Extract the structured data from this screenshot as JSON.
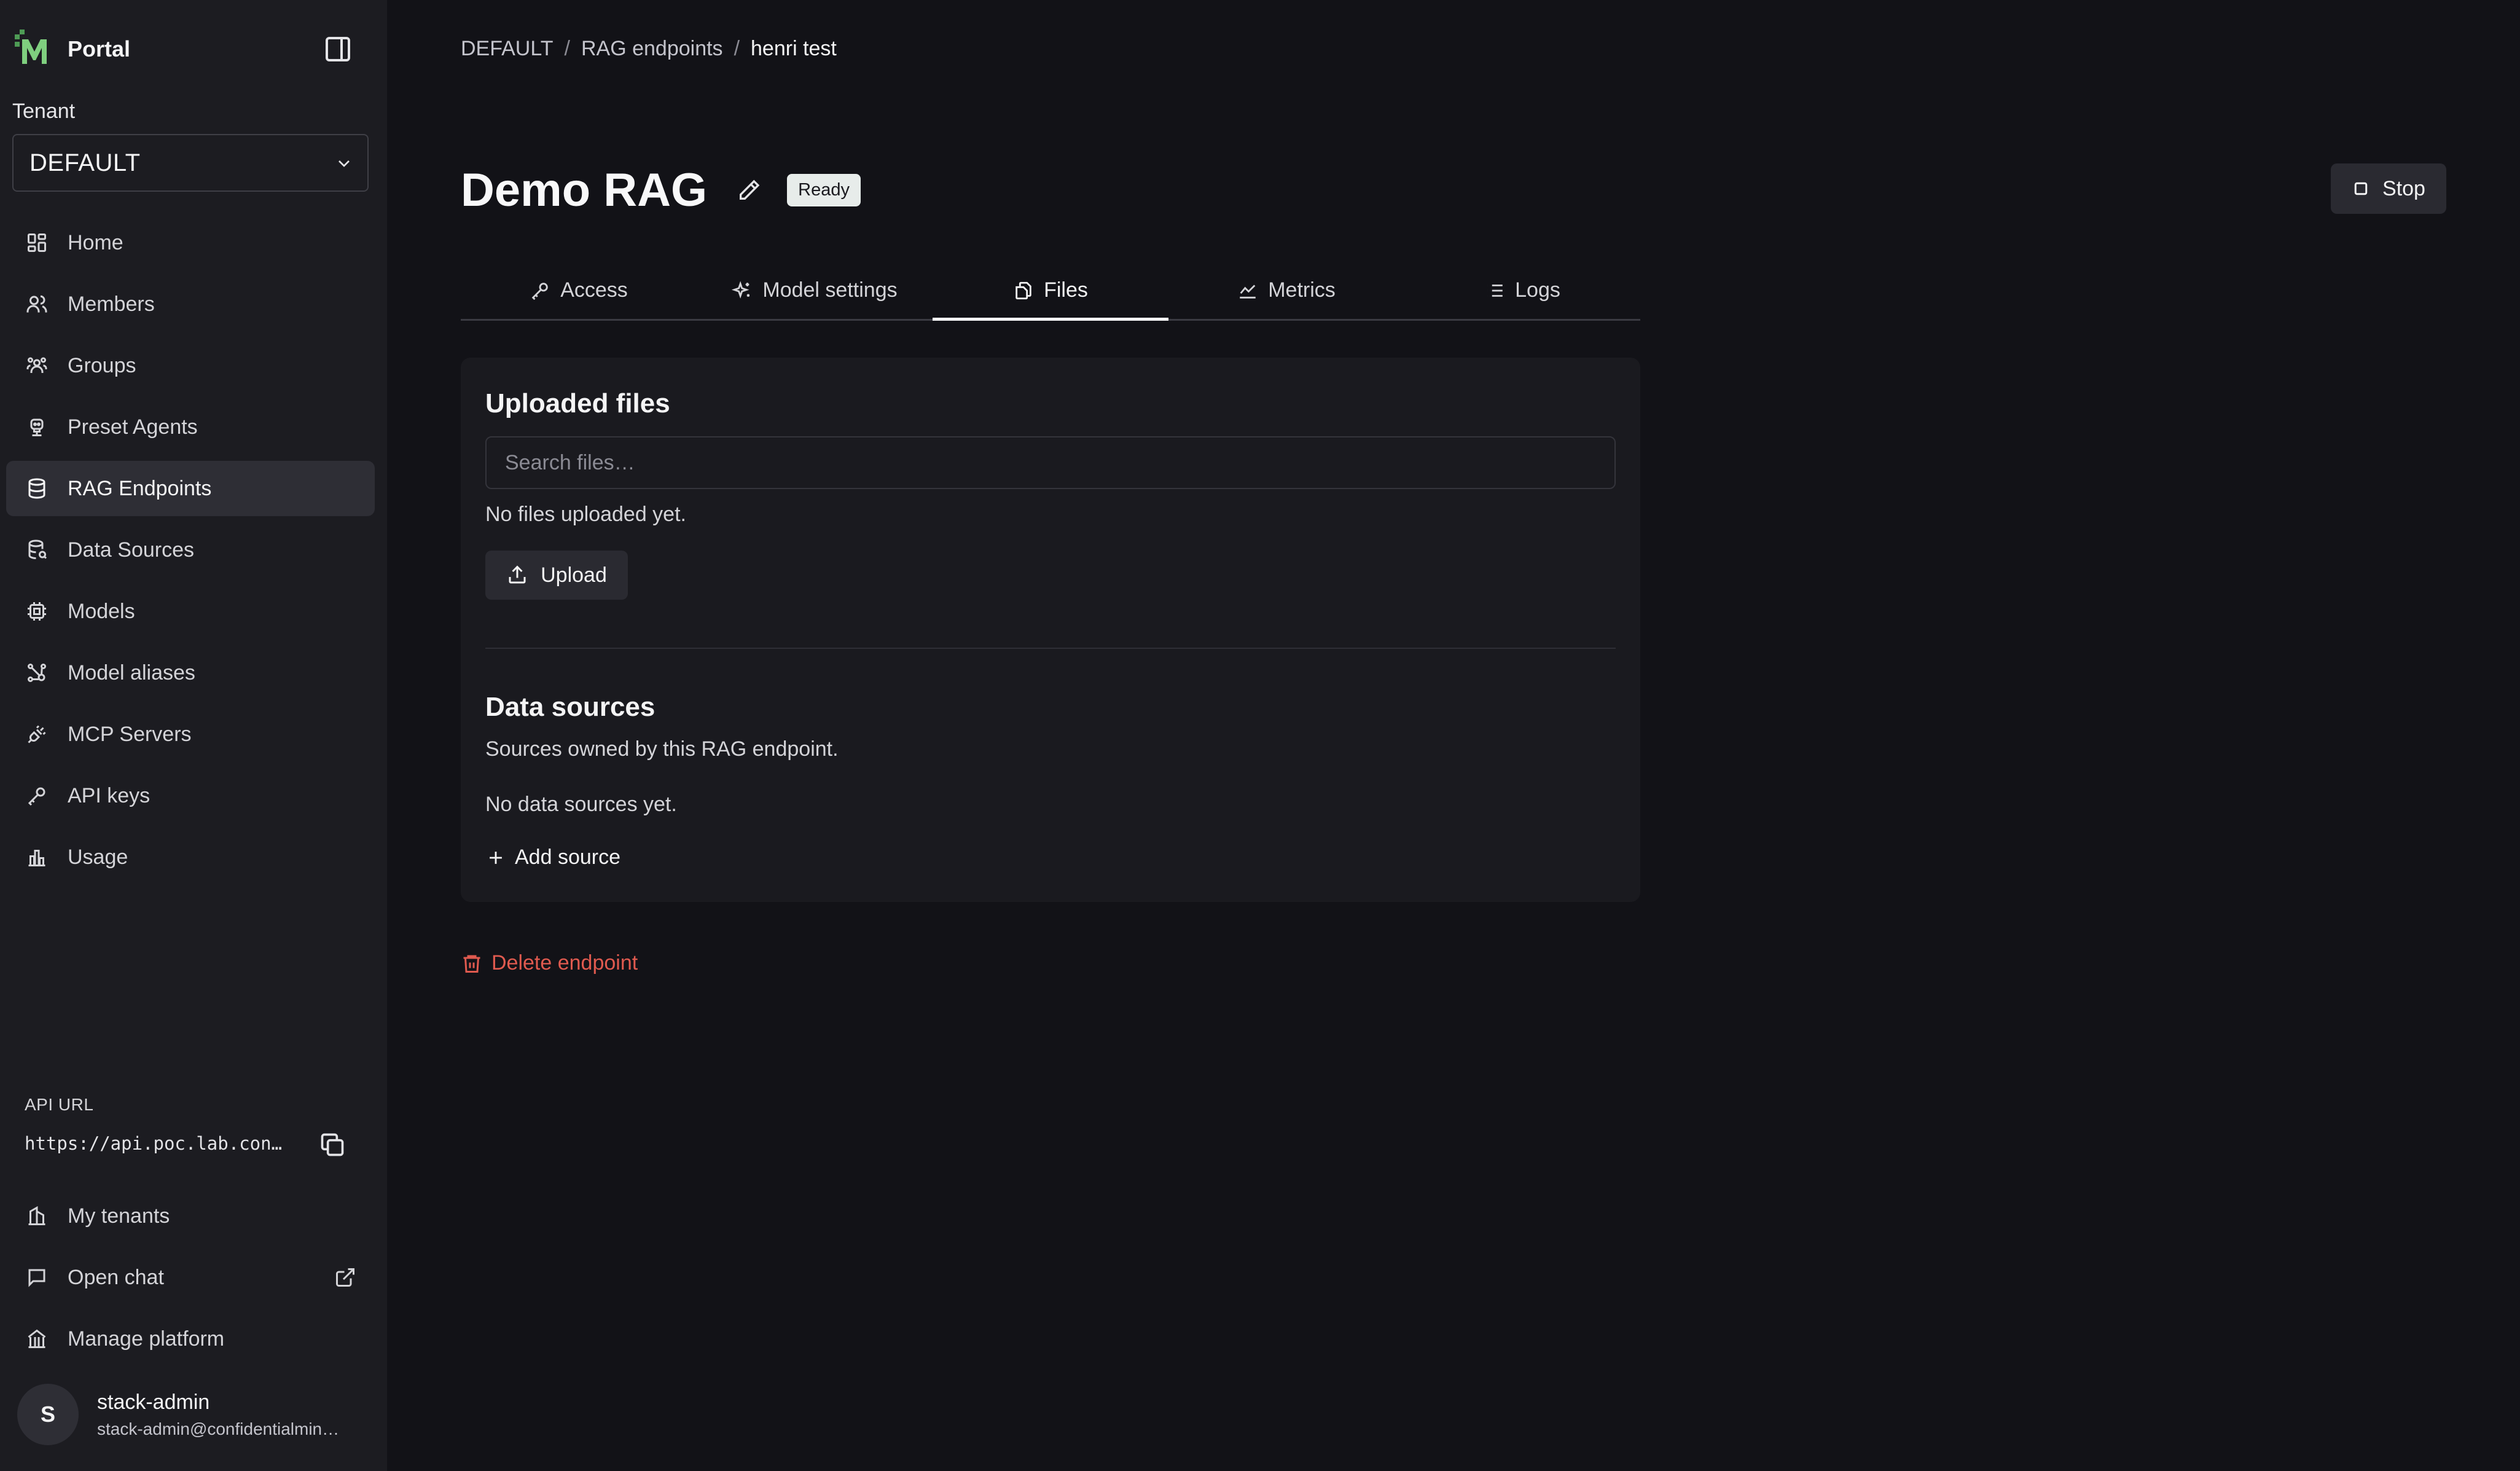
{
  "app": {
    "name": "Portal"
  },
  "sidebar": {
    "tenant_label": "Tenant",
    "tenant_value": "DEFAULT",
    "items": [
      {
        "label": "Home",
        "icon": "dashboard-icon"
      },
      {
        "label": "Members",
        "icon": "users-icon"
      },
      {
        "label": "Groups",
        "icon": "group-icon"
      },
      {
        "label": "Preset Agents",
        "icon": "robot-icon"
      },
      {
        "label": "RAG Endpoints",
        "icon": "database-icon",
        "active": true
      },
      {
        "label": "Data Sources",
        "icon": "database-search-icon"
      },
      {
        "label": "Models",
        "icon": "cpu-icon"
      },
      {
        "label": "Model aliases",
        "icon": "share-nodes-icon"
      },
      {
        "label": "MCP Servers",
        "icon": "plug-icon"
      },
      {
        "label": "API keys",
        "icon": "key-icon"
      },
      {
        "label": "Usage",
        "icon": "bar-chart-icon"
      }
    ],
    "api_url_label": "API URL",
    "api_url": "https://api.poc.lab.con…",
    "bottom_items": [
      {
        "label": "My tenants",
        "icon": "building-icon"
      },
      {
        "label": "Open chat",
        "icon": "chat-icon"
      },
      {
        "label": "Manage platform",
        "icon": "landmark-icon"
      }
    ],
    "user": {
      "initial": "S",
      "name": "stack-admin",
      "email": "stack-admin@confidentialmin…"
    }
  },
  "breadcrumb": [
    "DEFAULT",
    "RAG endpoints",
    "henri test"
  ],
  "page": {
    "title": "Demo RAG",
    "status": "Ready",
    "stop_label": "Stop"
  },
  "tabs": [
    {
      "label": "Access",
      "icon": "key-icon"
    },
    {
      "label": "Model settings",
      "icon": "sparkles-icon"
    },
    {
      "label": "Files",
      "icon": "files-icon",
      "active": true
    },
    {
      "label": "Metrics",
      "icon": "line-chart-icon"
    },
    {
      "label": "Logs",
      "icon": "list-icon"
    }
  ],
  "files": {
    "title": "Uploaded files",
    "search_placeholder": "Search files…",
    "empty": "No files uploaded yet.",
    "upload_label": "Upload"
  },
  "data_sources": {
    "title": "Data sources",
    "subtitle": "Sources owned by this RAG endpoint.",
    "empty": "No data sources yet.",
    "add_label": "Add source"
  },
  "delete_label": "Delete endpoint",
  "colors": {
    "background": "#121217",
    "sidebar": "#1c1c21",
    "danger": "#e05a4f",
    "badge": "#e7ecea",
    "logo_green": "#6fbf73"
  }
}
